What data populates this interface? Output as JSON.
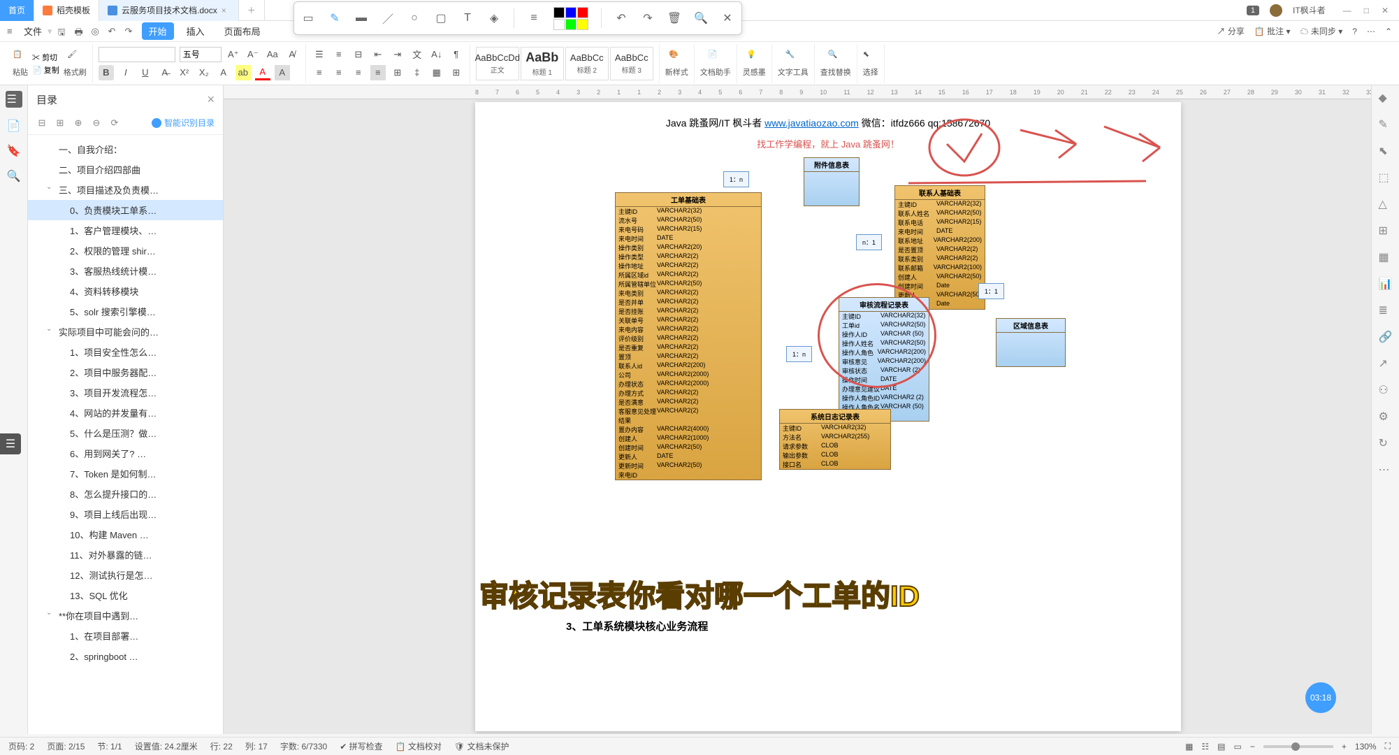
{
  "titlebar": {
    "home_tab": "首页",
    "template_tab": "稻壳模板",
    "doc_tab": "云服务项目技术文档.docx",
    "badge": "1",
    "username": "IT枫斗者"
  },
  "floating_toolbar": {
    "colors": [
      "#000000",
      "#0000ff",
      "#ff0000",
      "#ffffff",
      "#00ff00",
      "#ffff00"
    ]
  },
  "menubar": {
    "file": "文件",
    "items": [
      "开始",
      "插入",
      "页面布局"
    ],
    "share": "分享",
    "comment": "批注",
    "sync": "未同步"
  },
  "ribbon": {
    "paste": "粘贴",
    "cut": "剪切",
    "copy": "复制",
    "format_painter": "格式刷",
    "font_name": "",
    "font_size": "五号",
    "styles": [
      {
        "preview": "AaBbCcDd",
        "label": "正文"
      },
      {
        "preview": "AaBb",
        "label": "标题 1"
      },
      {
        "preview": "AaBbCc",
        "label": "标题 2"
      },
      {
        "preview": "AaBbCc",
        "label": "标题 3"
      }
    ],
    "new_style": "新样式",
    "doc_helper": "文档助手",
    "inspiration": "灵感墨",
    "text_tools": "文字工具",
    "find_replace": "查找替换",
    "select": "选择"
  },
  "sidebar": {
    "title": "目录",
    "smart_toc": "智能识别目录",
    "items": [
      {
        "level": 2,
        "text": "一、自我介绍："
      },
      {
        "level": 2,
        "text": "二、项目介绍四部曲"
      },
      {
        "level": 2,
        "text": "三、项目描述及负责模…",
        "expandable": true,
        "expanded": true
      },
      {
        "level": 3,
        "text": "0、负责模块工单系…",
        "selected": true
      },
      {
        "level": 3,
        "text": "1、客户管理模块、…"
      },
      {
        "level": 3,
        "text": "2、权限的管理 shir…"
      },
      {
        "level": 3,
        "text": "3、客服热线统计模…"
      },
      {
        "level": 3,
        "text": "4、资料转移模块"
      },
      {
        "level": 3,
        "text": "5、solr 搜索引擎模…"
      },
      {
        "level": 2,
        "text": "实际项目中可能会问的…",
        "expandable": true,
        "expanded": true
      },
      {
        "level": 3,
        "text": "1、项目安全性怎么…"
      },
      {
        "level": 3,
        "text": "2、项目中服务器配…"
      },
      {
        "level": 3,
        "text": "3、项目开发流程怎…"
      },
      {
        "level": 3,
        "text": "4、网站的并发量有…"
      },
      {
        "level": 3,
        "text": "5、什么是压测？做…"
      },
      {
        "level": 3,
        "text": "6、用到网关了? …"
      },
      {
        "level": 3,
        "text": "7、Token 是如何制…"
      },
      {
        "level": 3,
        "text": "8、怎么提升接口的…"
      },
      {
        "level": 3,
        "text": "9、项目上线后出现…"
      },
      {
        "level": 3,
        "text": "10、构建 Maven …"
      },
      {
        "level": 3,
        "text": "11、对外暴露的链…"
      },
      {
        "level": 3,
        "text": "12、测试执行是怎…"
      },
      {
        "level": 3,
        "text": "13、SQL 优化"
      },
      {
        "level": 2,
        "text": "**你在项目中遇到…",
        "expandable": true,
        "expanded": true
      },
      {
        "level": 3,
        "text": "1、在项目部署…"
      },
      {
        "level": 3,
        "text": "2、springboot …"
      }
    ]
  },
  "page": {
    "header_prefix": "Java 跳蚤网/IT 枫斗者  ",
    "header_link": "www.javatiaozao.com",
    "header_suffix": "  微信：itfdz666    qq:158672670",
    "subheader": "找工作学编程，就上 Java 跳蚤网！",
    "section_title": "3、工单系统模块核心业务流程",
    "tables": {
      "main": {
        "title": "工单基础表",
        "rows": [
          [
            "主键ID",
            "VARCHAR2(32)"
          ],
          [
            "流水号",
            "VARCHAR2(50)"
          ],
          [
            "来电号码",
            "VARCHAR2(15)"
          ],
          [
            "来电时间",
            "DATE"
          ],
          [
            "操作类别",
            "VARCHAR2(20)"
          ],
          [
            "操作类型",
            "VARCHAR2(2)"
          ],
          [
            "操作地址",
            "VARCHAR2(2)"
          ],
          [
            "所属区域id",
            "VARCHAR2(2)"
          ],
          [
            "所属管辖单位",
            "VARCHAR2(50)"
          ],
          [
            "来电类别",
            "VARCHAR2(2)"
          ],
          [
            "是否并单",
            "VARCHAR2(2)"
          ],
          [
            "是否挂账",
            "VARCHAR2(2)"
          ],
          [
            "关联单号",
            "VARCHAR2(2)"
          ],
          [
            "来电内容",
            "VARCHAR2(2)"
          ],
          [
            "评价级别",
            "VARCHAR2(2)"
          ],
          [
            "是否重复",
            "VARCHAR2(2)"
          ],
          [
            "置顶",
            "VARCHAR2(2)"
          ],
          [
            "联系人id",
            "VARCHAR2(200)"
          ],
          [
            "公司",
            "VARCHAR2(2000)"
          ],
          [
            "办理状态",
            "VARCHAR2(2000)"
          ],
          [
            "办理方式",
            "VARCHAR2(2)"
          ],
          [
            "是否满意",
            "VARCHAR2(2)"
          ],
          [
            "客服意见处理结果",
            "VARCHAR2(2)"
          ],
          [
            "置办内容",
            "VARCHAR2(4000)"
          ],
          [
            "创建人",
            "VARCHAR2(1000)"
          ],
          [
            "创建时间",
            "VARCHAR2(50)"
          ],
          [
            "更新人",
            "DATE"
          ],
          [
            "更新时间",
            "VARCHAR2(50)"
          ],
          [
            "来电ID",
            ""
          ]
        ]
      },
      "contact": {
        "title": "联系人基础表",
        "rows": [
          [
            "主键ID",
            "VARCHAR2(32)"
          ],
          [
            "联系人姓名",
            "VARCHAR2(50)"
          ],
          [
            "联系电话",
            "VARCHAR2(15)"
          ],
          [
            "来电时间",
            "DATE"
          ],
          [
            "联系地址",
            "VARCHAR2(200)"
          ],
          [
            "是否置顶",
            "VARCHAR2(2)"
          ],
          [
            "联系类别",
            "VARCHAR2(2)"
          ],
          [
            "联系邮箱",
            "VARCHAR2(100)"
          ],
          [
            "创建人",
            "VARCHAR2(50)"
          ],
          [
            "创建时间",
            "Date"
          ],
          [
            "更新人",
            "VARCHAR2(50)"
          ],
          [
            "更新时间",
            "Date"
          ]
        ]
      },
      "audit": {
        "title": "审核流程记录表",
        "rows": [
          [
            "主键ID",
            "VARCHAR2(32)"
          ],
          [
            "工单id",
            "VARCHAR2(50)"
          ],
          [
            "操作人ID",
            "VARCHAR (50)"
          ],
          [
            "操作人姓名",
            "VARCHAR2(50)"
          ],
          [
            "操作人角色",
            "VARCHAR2(200)"
          ],
          [
            "审核意见",
            "VARCHAR2(200)"
          ],
          [
            "审核状态",
            "VARCHAR (2)"
          ],
          [
            "操作时间",
            "DATE"
          ],
          [
            "办理意见建议",
            "DATE"
          ],
          [
            "操作人角色ID",
            "VARCHAR2 (2)"
          ],
          [
            "操作人角色名称",
            "VARCHAR (50)"
          ]
        ]
      },
      "log": {
        "title": "系统日志记录表",
        "rows": [
          [
            "主键ID",
            "VARCHAR2(32)"
          ],
          [
            "方法名",
            "VARCHAR2(255)"
          ],
          [
            "请求参数",
            "CLOB"
          ],
          [
            "输出参数",
            "CLOB"
          ],
          [
            "接口名",
            "CLOB"
          ]
        ]
      },
      "area": {
        "title": "区域信息表"
      },
      "file": {
        "title": "附件信息表"
      }
    },
    "relations": {
      "r1": "1：n",
      "r2": "n：1",
      "r3": "1：1",
      "r4": "1：n"
    }
  },
  "subtitle": "审核记录表你看对哪一个工单的ID",
  "time_badge": "03:18",
  "statusbar": {
    "page_no": "页码: 2",
    "pages": "页面: 2/15",
    "section": "节: 1/1",
    "setting": "设置值: 24.2厘米",
    "line": "行: 22",
    "col": "列: 17",
    "words": "字数: 6/7330",
    "spellcheck": "拼写检查",
    "doc_proof": "文档校对",
    "doc_protect": "文档未保护",
    "zoom": "130%"
  }
}
